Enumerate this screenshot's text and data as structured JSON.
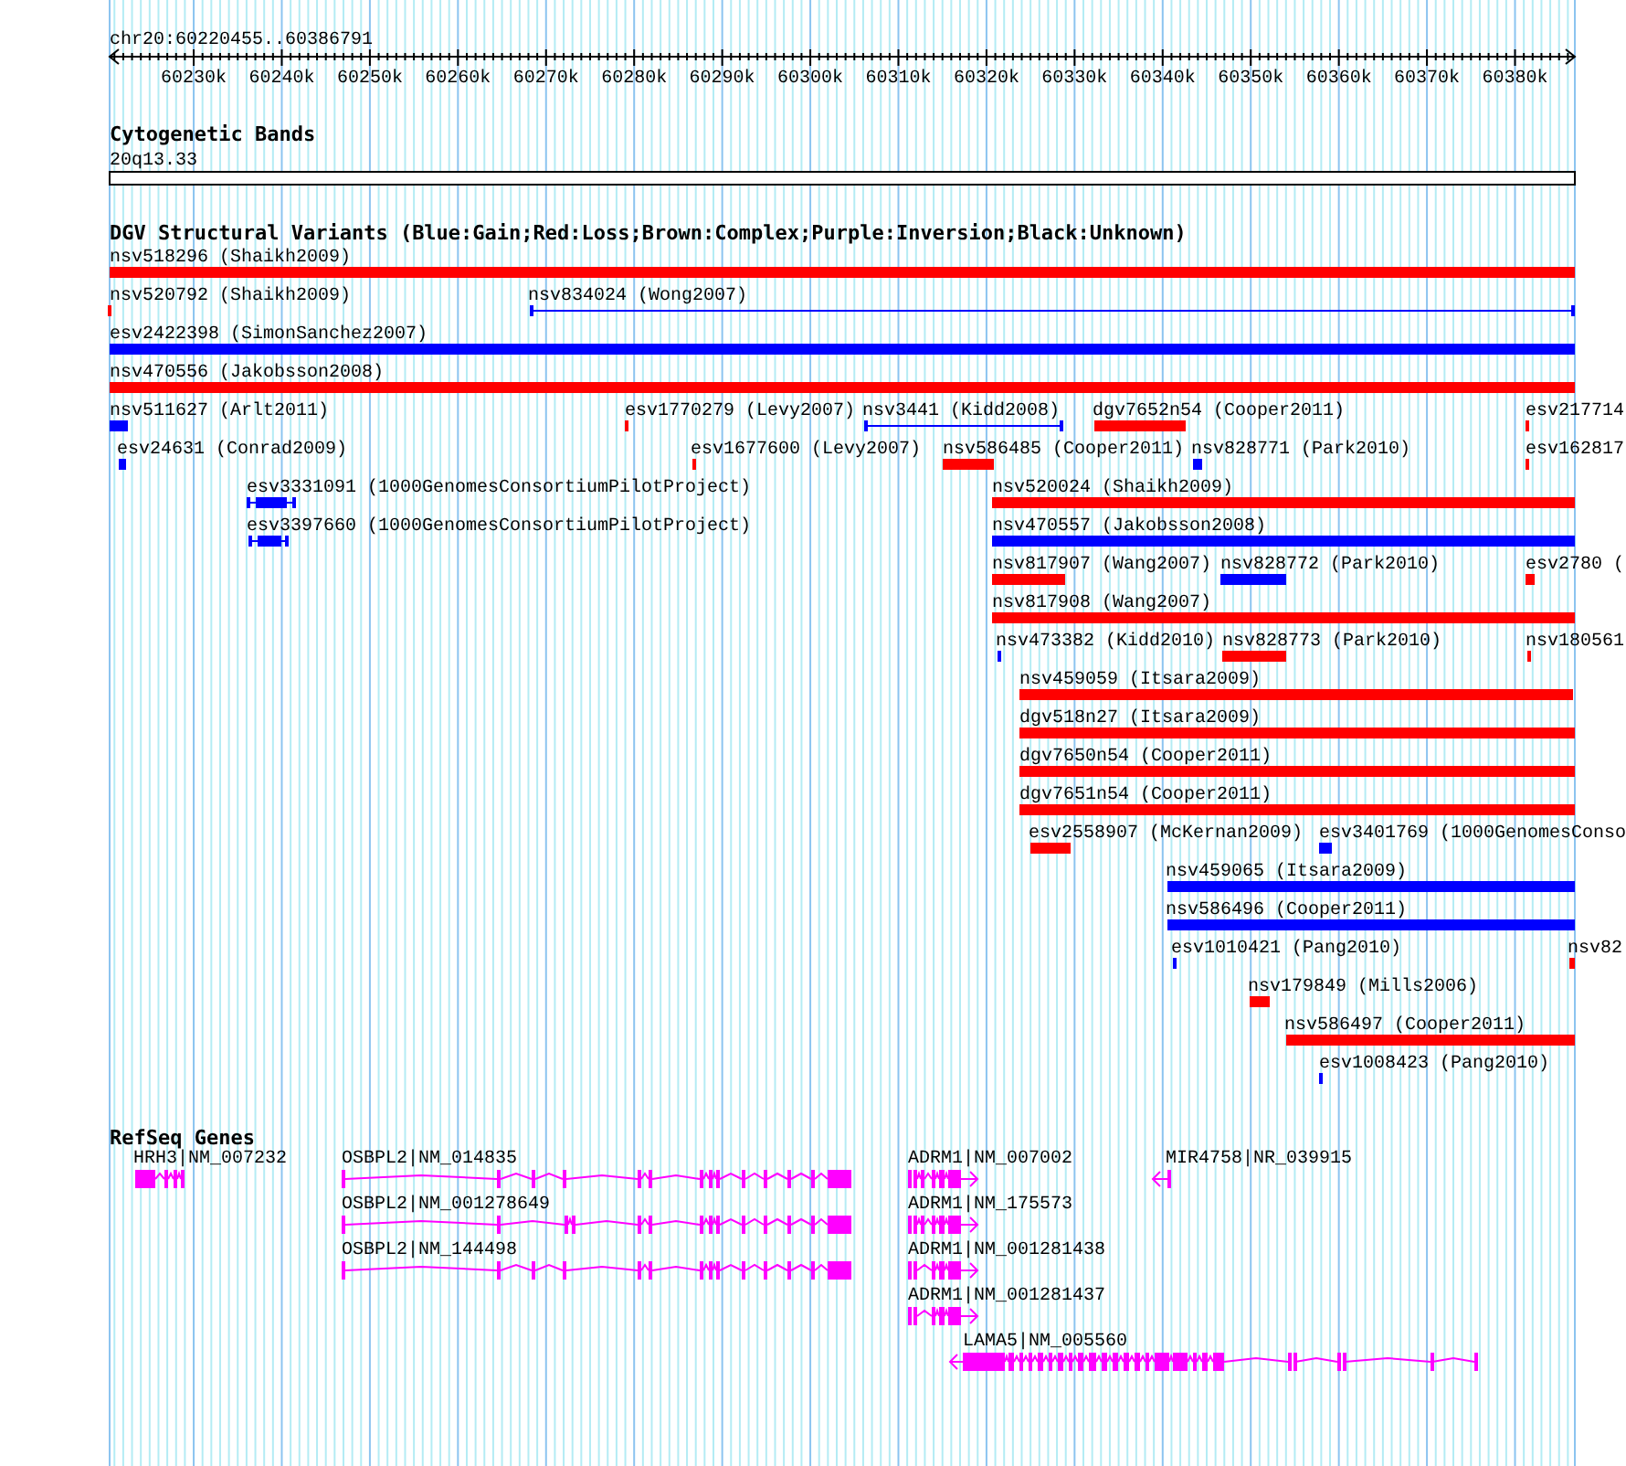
{
  "ruler": {
    "region": "chr20:60220455..60386791",
    "ticks": [
      "60230k",
      "60240k",
      "60250k",
      "60260k",
      "60270k",
      "60280k",
      "60290k",
      "60300k",
      "60310k",
      "60320k",
      "60330k",
      "60340k",
      "60350k",
      "60360k",
      "60370k",
      "60380k"
    ]
  },
  "cytogenetic_bands": {
    "title": "Cytogenetic Bands",
    "band": "20q13.33"
  },
  "dgv_variants": {
    "title": "DGV Structural Variants (Blue:Gain;Red:Loss;Brown:Complex;Purple:Inversion;Black:Unknown)",
    "features": [
      {
        "label": "nsv518296 (Shaikh2009)",
        "color": "#ff0000",
        "kind": "bar"
      },
      {
        "label": "nsv520792 (Shaikh2009)",
        "color": "#ff0000",
        "kind": "bar"
      },
      {
        "label": "nsv834024 (Wong2007)",
        "color": "#0000ff",
        "kind": "span"
      },
      {
        "label": "esv2422398 (SimonSanchez2007)",
        "color": "#0000ff",
        "kind": "bar"
      },
      {
        "label": "nsv470556 (Jakobsson2008)",
        "color": "#ff0000",
        "kind": "bar"
      },
      {
        "label": "nsv511627 (Arlt2011)",
        "color": "#0000ff",
        "kind": "capped"
      },
      {
        "label": "esv1770279 (Levy2007)",
        "color": "#ff0000",
        "kind": "bar"
      },
      {
        "label": "nsv3441 (Kidd2008)",
        "color": "#0000ff",
        "kind": "span"
      },
      {
        "label": "dgv7652n54 (Cooper2011)",
        "color": "#ff0000",
        "kind": "bar"
      },
      {
        "label": "esv217714",
        "color": "#ff0000",
        "kind": "bar"
      },
      {
        "label": "esv24631 (Conrad2009)",
        "color": "#0000ff",
        "kind": "bar"
      },
      {
        "label": "esv1677600 (Levy2007)",
        "color": "#ff0000",
        "kind": "bar"
      },
      {
        "label": "nsv586485 (Cooper2011)",
        "color": "#ff0000",
        "kind": "bar"
      },
      {
        "label": "nsv828771 (Park2010)",
        "color": "#0000ff",
        "kind": "bar"
      },
      {
        "label": "esv162817",
        "color": "#ff0000",
        "kind": "bar"
      },
      {
        "label": "esv3331091 (1000GenomesConsortiumPilotProject)",
        "color": "#0000ff",
        "kind": "capped"
      },
      {
        "label": "esv3397660 (1000GenomesConsortiumPilotProject)",
        "color": "#0000ff",
        "kind": "capped"
      },
      {
        "label": "nsv520024 (Shaikh2009)",
        "color": "#ff0000",
        "kind": "bar"
      },
      {
        "label": "nsv470557 (Jakobsson2008)",
        "color": "#0000ff",
        "kind": "bar"
      },
      {
        "label": "nsv817907 (Wang2007)",
        "color": "#ff0000",
        "kind": "bar"
      },
      {
        "label": "nsv828772 (Park2010)",
        "color": "#0000ff",
        "kind": "bar"
      },
      {
        "label": "esv2780 (",
        "color": "#ff0000",
        "kind": "bar"
      },
      {
        "label": "nsv817908 (Wang2007)",
        "color": "#ff0000",
        "kind": "bar"
      },
      {
        "label": "nsv473382 (Kidd2010)",
        "color": "#0000ff",
        "kind": "bar"
      },
      {
        "label": "nsv828773 (Park2010)",
        "color": "#ff0000",
        "kind": "bar"
      },
      {
        "label": "nsv180561",
        "color": "#ff0000",
        "kind": "bar"
      },
      {
        "label": "nsv459059 (Itsara2009)",
        "color": "#ff0000",
        "kind": "bar"
      },
      {
        "label": "dgv518n27 (Itsara2009)",
        "color": "#ff0000",
        "kind": "bar"
      },
      {
        "label": "dgv7650n54 (Cooper2011)",
        "color": "#ff0000",
        "kind": "bar"
      },
      {
        "label": "dgv7651n54 (Cooper2011)",
        "color": "#ff0000",
        "kind": "bar"
      },
      {
        "label": "esv2558907 (McKernan2009)",
        "color": "#ff0000",
        "kind": "bar"
      },
      {
        "label": "esv3401769 (1000GenomesConso",
        "color": "#0000ff",
        "kind": "bar"
      },
      {
        "label": "nsv459065 (Itsara2009)",
        "color": "#0000ff",
        "kind": "bar"
      },
      {
        "label": "nsv586496 (Cooper2011)",
        "color": "#0000ff",
        "kind": "bar"
      },
      {
        "label": "esv1010421 (Pang2010)",
        "color": "#0000ff",
        "kind": "bar"
      },
      {
        "label": "nsv82",
        "color": "#ff0000",
        "kind": "bar"
      },
      {
        "label": "nsv179849 (Mills2006)",
        "color": "#ff0000",
        "kind": "bar"
      },
      {
        "label": "nsv586497 (Cooper2011)",
        "color": "#ff0000",
        "kind": "bar"
      },
      {
        "label": "esv1008423 (Pang2010)",
        "color": "#0000ff",
        "kind": "bar"
      }
    ]
  },
  "refseq_genes": {
    "title": "RefSeq Genes",
    "genes": [
      {
        "label": "HRH3|NM_007232",
        "kind": "plain"
      },
      {
        "label": "OSBPL2|NM_014835",
        "kind": "plain"
      },
      {
        "label": "ADRM1|NM_007002",
        "kind": "forward"
      },
      {
        "label": "MIR4758|NR_039915",
        "kind": "reverse"
      },
      {
        "label": "OSBPL2|NM_001278649",
        "kind": "plain"
      },
      {
        "label": "ADRM1|NM_175573",
        "kind": "forward"
      },
      {
        "label": "OSBPL2|NM_144498",
        "kind": "plain"
      },
      {
        "label": "ADRM1|NM_001281438",
        "kind": "forward"
      },
      {
        "label": "ADRM1|NM_001281437",
        "kind": "forward"
      },
      {
        "label": "LAMA5|NM_005560",
        "kind": "reverse"
      }
    ]
  }
}
